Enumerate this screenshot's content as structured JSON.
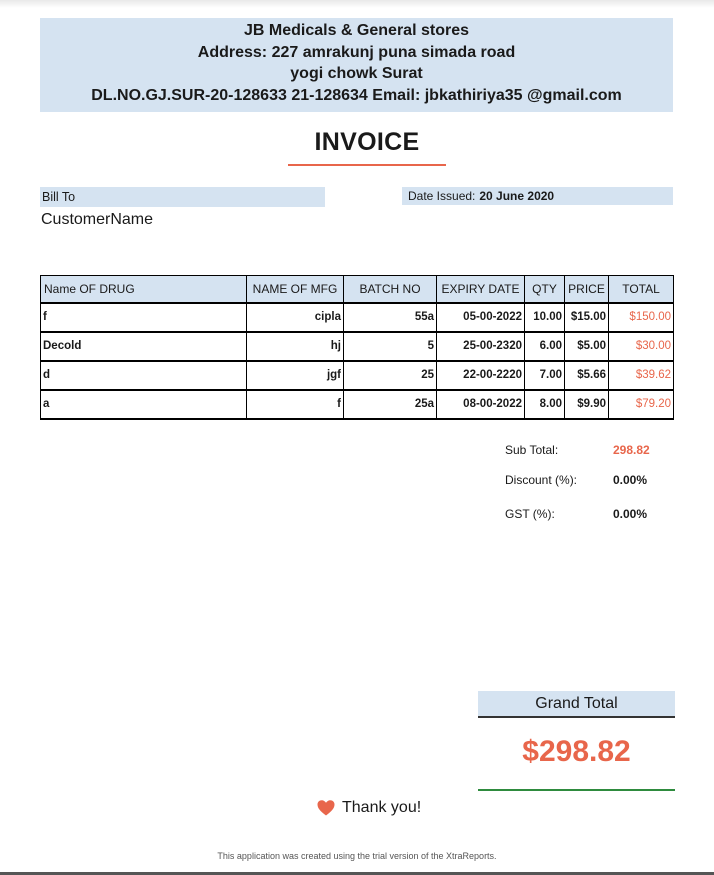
{
  "header": {
    "store_name": "JB Medicals & General stores",
    "address_line1": "Address: 227 amrakunj puna simada road",
    "address_line2": "yogi chowk Surat",
    "license_line": "DL.NO.GJ.SUR-20-128633 21-128634 Email: jbkathiriya35 @gmail.com"
  },
  "title": "INVOICE",
  "bill_to": {
    "label": "Bill To",
    "customer": "CustomerName"
  },
  "date": {
    "label": "Date Issued:",
    "value": "20 June 2020"
  },
  "table": {
    "headers": [
      "Name OF DRUG",
      "NAME OF MFG",
      "BATCH NO",
      "EXPIRY DATE",
      "QTY",
      "PRICE",
      "TOTAL"
    ],
    "rows": [
      [
        "f",
        "cipla",
        "55a",
        "05-00-2022",
        "10.00",
        "$15.00",
        "$150.00"
      ],
      [
        "Decold",
        "hj",
        "5",
        "25-00-2320",
        "6.00",
        "$5.00",
        "$30.00"
      ],
      [
        "d",
        "jgf",
        "25",
        "22-00-2220",
        "7.00",
        "$5.66",
        "$39.62"
      ],
      [
        "a",
        "f",
        "25a",
        "08-00-2022",
        "8.00",
        "$9.90",
        "$79.20"
      ]
    ]
  },
  "summary": {
    "subtotal_label": "Sub Total:",
    "subtotal_value": "298.82",
    "discount_label": "Discount (%):",
    "discount_value": "0.00%",
    "gst_label": "GST (%):",
    "gst_value": "0.00%"
  },
  "grand_total": {
    "label": "Grand Total",
    "value": "$298.82"
  },
  "thanks": "Thank you!",
  "footer": "This application was created using the trial version of the XtraReports.",
  "colors": {
    "accent": "#e8664b",
    "header_bg": "#d5e3f1",
    "green_line": "#2e8b3e"
  },
  "icons": {
    "thanks": "heart-icon"
  }
}
